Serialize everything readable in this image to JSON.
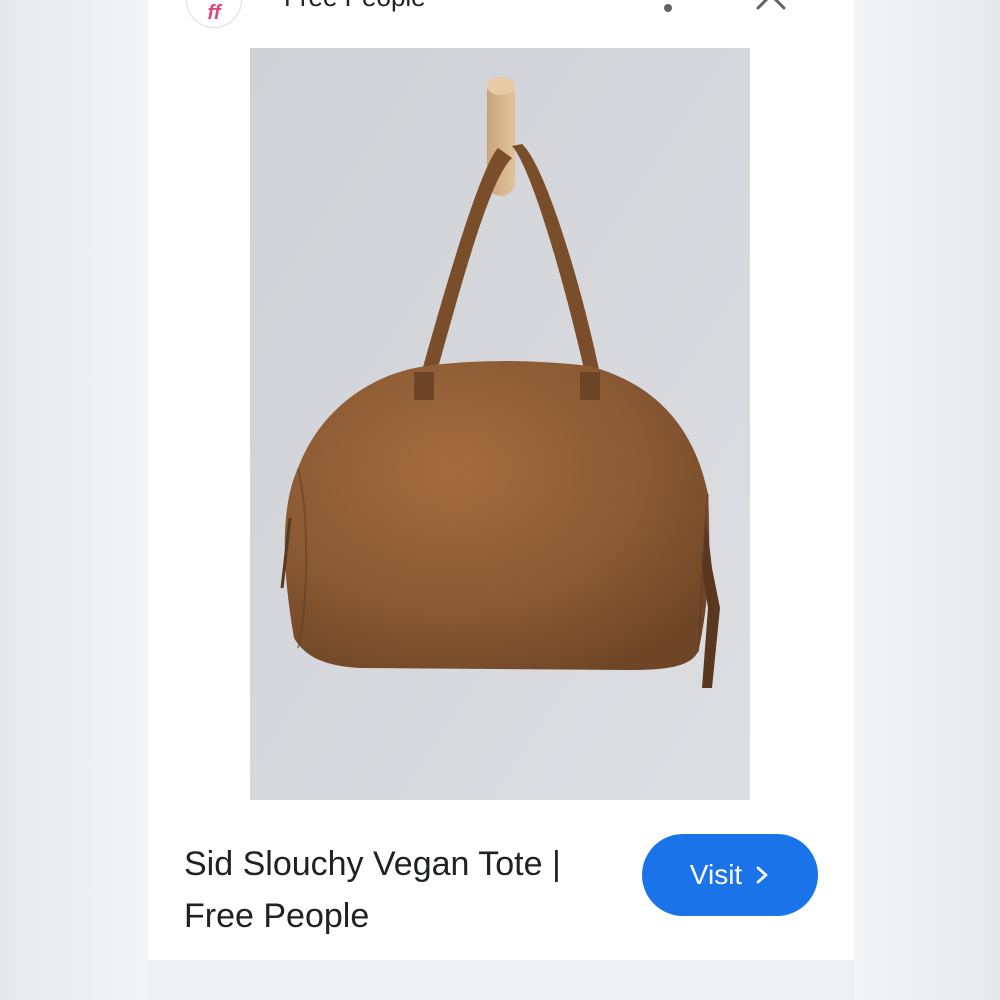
{
  "header": {
    "site_name": "Free People",
    "favicon_icon": "free-people-logo",
    "more_icon": "more-vertical-icon",
    "close_icon": "close-icon"
  },
  "product": {
    "title": "Sid Slouchy Vegan Tote | Free People",
    "image_subject": "brown slouchy vegan leather tote bag hanging on a wooden wall hook"
  },
  "actions": {
    "visit_label": "Visit",
    "visit_icon": "chevron-right-icon"
  },
  "colors": {
    "accent": "#1a73e8",
    "brand_pink": "#e0457b",
    "wall": "#d3d5d9",
    "bag": "#8a5a33"
  }
}
